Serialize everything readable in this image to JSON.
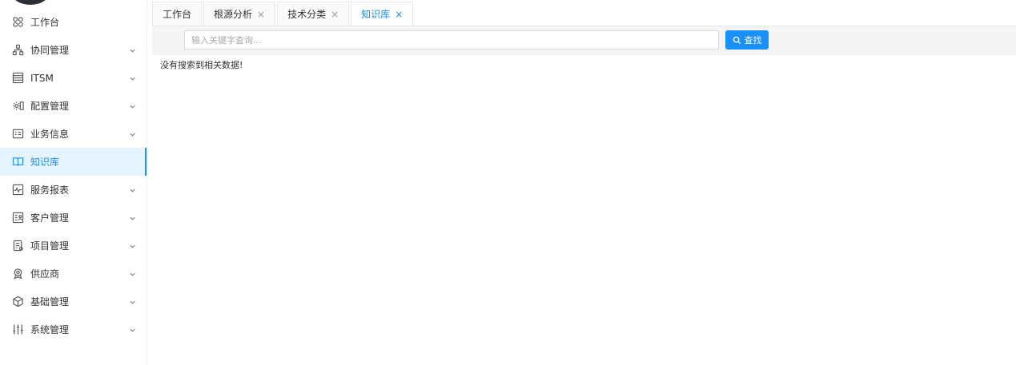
{
  "sidebar": {
    "items": [
      {
        "label": "工作台",
        "icon": "grid-icon",
        "expandable": false,
        "active": false
      },
      {
        "label": "协同管理",
        "icon": "org-chart-icon",
        "expandable": true,
        "active": false
      },
      {
        "label": "ITSM",
        "icon": "list-icon",
        "expandable": true,
        "active": false
      },
      {
        "label": "配置管理",
        "icon": "config-icon",
        "expandable": true,
        "active": false
      },
      {
        "label": "业务信息",
        "icon": "id-card-icon",
        "expandable": true,
        "active": false
      },
      {
        "label": "知识库",
        "icon": "book-icon",
        "expandable": false,
        "active": true
      },
      {
        "label": "服务报表",
        "icon": "chart-icon",
        "expandable": true,
        "active": false
      },
      {
        "label": "客户管理",
        "icon": "customer-icon",
        "expandable": true,
        "active": false
      },
      {
        "label": "项目管理",
        "icon": "project-icon",
        "expandable": true,
        "active": false
      },
      {
        "label": "供应商",
        "icon": "supplier-icon",
        "expandable": true,
        "active": false
      },
      {
        "label": "基础管理",
        "icon": "cube-icon",
        "expandable": true,
        "active": false
      },
      {
        "label": "系统管理",
        "icon": "sliders-icon",
        "expandable": true,
        "active": false
      }
    ]
  },
  "tabs": [
    {
      "label": "工作台",
      "closable": false,
      "active": false
    },
    {
      "label": "根源分析",
      "closable": true,
      "active": false
    },
    {
      "label": "技术分类",
      "closable": true,
      "active": false
    },
    {
      "label": "知识库",
      "closable": true,
      "active": true
    }
  ],
  "tab_close_glyph": "×",
  "search": {
    "placeholder": "输入关键字查询...",
    "value": "",
    "button_label": "查找"
  },
  "result": {
    "empty_message": "没有搜索到相关数据!"
  },
  "colors": {
    "accent": "#1890ff",
    "active_bg": "#e6f4ff"
  }
}
